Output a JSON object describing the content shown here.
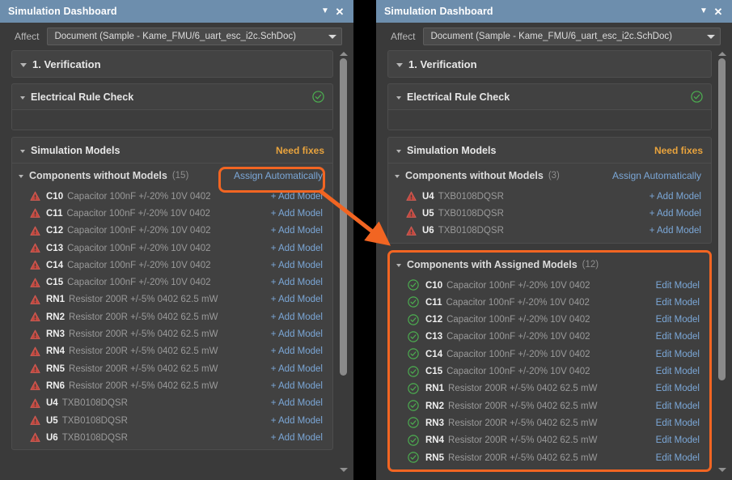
{
  "window": {
    "title": "Simulation Dashboard",
    "minimize_icon": "chevron-down-icon",
    "close_icon": "close-icon"
  },
  "affect": {
    "label": "Affect",
    "value": "Document (Sample - Kame_FMU/6_uart_esc_i2c.SchDoc)",
    "dropdown_icon": "chevron-down-icon"
  },
  "verification": {
    "title": "1. Verification"
  },
  "erc": {
    "title": "Electrical Rule Check",
    "status_icon": "check-circle-icon"
  },
  "sim_models": {
    "title": "Simulation Models",
    "status": "Need fixes"
  },
  "colors": {
    "accent_orange": "#f26522",
    "link_blue": "#7ba7d7",
    "warn_orange": "#e8a33d",
    "ok_green": "#4caf50",
    "error_red": "#c4483f",
    "titlebar_blue": "#6d8ead"
  },
  "left_panel": {
    "without_models": {
      "label": "Components without Models",
      "count": "(15)",
      "action": "Assign Automatically",
      "row_action": "+ Add Model",
      "row_icon": "warning-triangle-icon",
      "items": [
        {
          "designator": "C10",
          "description": "Capacitor 100nF +/-20% 10V 0402"
        },
        {
          "designator": "C11",
          "description": "Capacitor 100nF +/-20% 10V 0402"
        },
        {
          "designator": "C12",
          "description": "Capacitor 100nF +/-20% 10V 0402"
        },
        {
          "designator": "C13",
          "description": "Capacitor 100nF +/-20% 10V 0402"
        },
        {
          "designator": "C14",
          "description": "Capacitor 100nF +/-20% 10V 0402"
        },
        {
          "designator": "C15",
          "description": "Capacitor 100nF +/-20% 10V 0402"
        },
        {
          "designator": "RN1",
          "description": "Resistor 200R +/-5% 0402 62.5 mW"
        },
        {
          "designator": "RN2",
          "description": "Resistor 200R +/-5% 0402 62.5 mW"
        },
        {
          "designator": "RN3",
          "description": "Resistor 200R +/-5% 0402 62.5 mW"
        },
        {
          "designator": "RN4",
          "description": "Resistor 200R +/-5% 0402 62.5 mW"
        },
        {
          "designator": "RN5",
          "description": "Resistor 200R +/-5% 0402 62.5 mW"
        },
        {
          "designator": "RN6",
          "description": "Resistor 200R +/-5% 0402 62.5 mW"
        },
        {
          "designator": "U4",
          "description": "TXB0108DQSR"
        },
        {
          "designator": "U5",
          "description": "TXB0108DQSR"
        },
        {
          "designator": "U6",
          "description": "TXB0108DQSR"
        }
      ]
    }
  },
  "right_panel": {
    "without_models": {
      "label": "Components without Models",
      "count": "(3)",
      "action": "Assign Automatically",
      "row_action": "+ Add Model",
      "row_icon": "warning-triangle-icon",
      "items": [
        {
          "designator": "U4",
          "description": "TXB0108DQSR"
        },
        {
          "designator": "U5",
          "description": "TXB0108DQSR"
        },
        {
          "designator": "U6",
          "description": "TXB0108DQSR"
        }
      ]
    },
    "with_models": {
      "label": "Components with Assigned Models",
      "count": "(12)",
      "row_action": "Edit Model",
      "row_icon": "check-circle-icon",
      "items": [
        {
          "designator": "C10",
          "description": "Capacitor 100nF +/-20% 10V 0402"
        },
        {
          "designator": "C11",
          "description": "Capacitor 100nF +/-20% 10V 0402"
        },
        {
          "designator": "C12",
          "description": "Capacitor 100nF +/-20% 10V 0402"
        },
        {
          "designator": "C13",
          "description": "Capacitor 100nF +/-20% 10V 0402"
        },
        {
          "designator": "C14",
          "description": "Capacitor 100nF +/-20% 10V 0402"
        },
        {
          "designator": "C15",
          "description": "Capacitor 100nF +/-20% 10V 0402"
        },
        {
          "designator": "RN1",
          "description": "Resistor 200R +/-5% 0402 62.5 mW"
        },
        {
          "designator": "RN2",
          "description": "Resistor 200R +/-5% 0402 62.5 mW"
        },
        {
          "designator": "RN3",
          "description": "Resistor 200R +/-5% 0402 62.5 mW"
        },
        {
          "designator": "RN4",
          "description": "Resistor 200R +/-5% 0402 62.5 mW"
        },
        {
          "designator": "RN5",
          "description": "Resistor 200R +/-5% 0402 62.5 mW"
        }
      ]
    }
  }
}
